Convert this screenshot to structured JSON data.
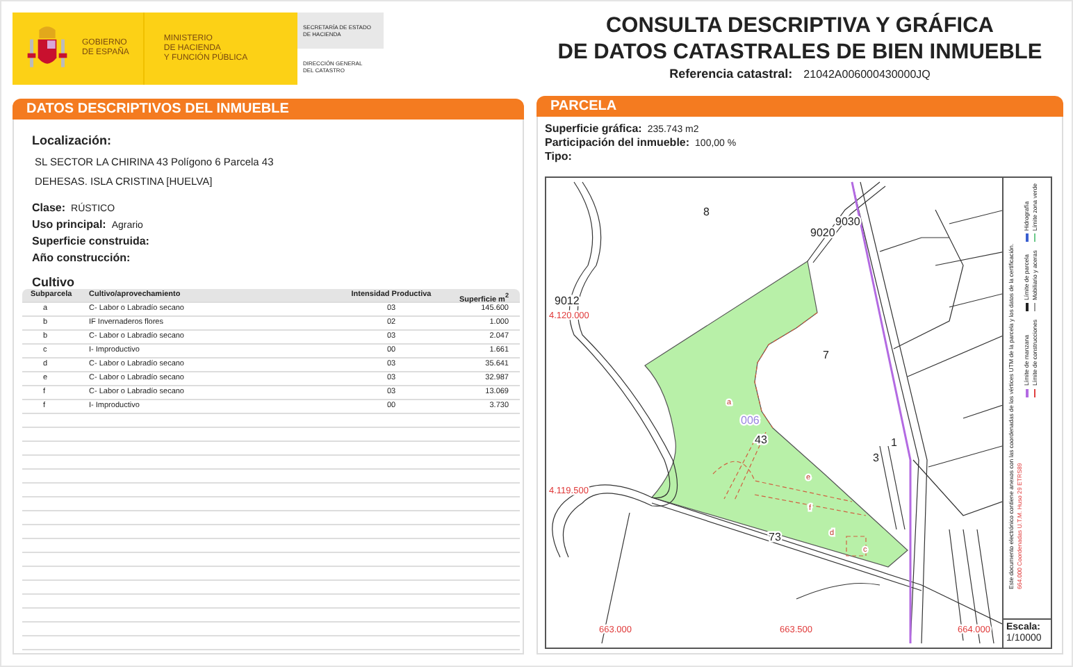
{
  "header": {
    "crown_lines": [
      "GOBIERNO",
      "DE ESPAÑA"
    ],
    "ministry_lines": [
      "MINISTERIO",
      "DE HACIENDA",
      "Y FUNCIÓN PÚBLICA"
    ],
    "secretaria_lines": [
      "SECRETARÍA DE ESTADO",
      "DE HACIENDA"
    ],
    "direccion_lines": [
      "DIRECCIÓN GENERAL",
      "DEL CATASTRO"
    ]
  },
  "title_lines": [
    "CONSULTA DESCRIPTIVA Y GRÁFICA",
    "DE DATOS CATASTRALES DE BIEN INMUEBLE"
  ],
  "reference": {
    "label": "Referencia catastral:",
    "value": "21042A006000430000JQ"
  },
  "descriptive": {
    "title": "DATOS DESCRIPTIVOS DEL **INMUEBLE**",
    "location_label": "Localización:",
    "address_lines": [
      "SL SECTOR LA CHIRINA 43 Polígono 6 Parcela 43",
      "DEHESAS. ISLA CRISTINA [HUELVA]"
    ],
    "fields": [
      {
        "label": "Clase:",
        "value": "RÚSTICO"
      },
      {
        "label": "Uso principal:",
        "value": "Agrario"
      },
      {
        "label": "Superficie construida:"
      },
      {
        "label": "Año construcción:"
      }
    ],
    "crop_title": "Cultivo",
    "table": {
      "columns": [
        "Subparcela",
        "Cultivo/aprovechamiento",
        "Intensidad Productiva",
        "Superficie m$^{2}$"
      ],
      "rows": [
        [
          "a",
          "C- Labor o Labradío secano",
          "03",
          "145.600"
        ],
        [
          "b",
          "IF Invernaderos flores",
          "02",
          "1.000"
        ],
        [
          "b",
          "C- Labor o Labradío secano",
          "03",
          "2.047"
        ],
        [
          "c",
          "I- Improductivo",
          "00",
          "1.661"
        ],
        [
          "d",
          "C- Labor o Labradío secano",
          "03",
          "35.641"
        ],
        [
          "e",
          "C- Labor o Labradío secano",
          "03",
          "32.987"
        ],
        [
          "f",
          "C- Labor o Labradío secano",
          "03",
          "13.069"
        ],
        [
          "f",
          "I- Improductivo",
          "00",
          "3.730"
        ]
      ]
    }
  },
  "parcela": {
    "title": "PARCELA",
    "fields": [
      {
        "label": "Superficie gráfica:",
        "value": "235.743 m2"
      },
      {
        "label": "Participación del inmueble:",
        "value": "100,00 %"
      },
      {
        "label": "Tipo:"
      }
    ]
  },
  "map": {
    "labels": [
      {
        "kind": "parcel",
        "text": "8"
      },
      {
        "kind": "parcel",
        "text": "9020"
      },
      {
        "kind": "parcel",
        "text": "9030"
      },
      {
        "kind": "parcel",
        "text": "9012"
      },
      {
        "kind": "parcel",
        "text": "7"
      },
      {
        "kind": "zone",
        "text": "006"
      },
      {
        "kind": "parcel",
        "text": "43"
      },
      {
        "kind": "parcel",
        "text": "1"
      },
      {
        "kind": "parcel",
        "text": "3"
      },
      {
        "kind": "parcel",
        "text": "73"
      },
      {
        "kind": "sub",
        "text": "a"
      },
      {
        "kind": "sub",
        "text": "e"
      },
      {
        "kind": "sub",
        "text": "f"
      },
      {
        "kind": "sub",
        "text": "d"
      },
      {
        "kind": "sub",
        "text": "c"
      },
      {
        "kind": "coord",
        "text": "4.120.000"
      },
      {
        "kind": "coord",
        "text": "4.119.500"
      },
      {
        "kind": "coord",
        "text": "663.000"
      },
      {
        "kind": "coord",
        "text": "663.500"
      },
      {
        "kind": "coord",
        "text": "664.000"
      }
    ],
    "legend": [
      {
        "label": "Límite de manzana",
        "color": "#b36ae2"
      },
      {
        "label": "Límite de parcela",
        "color": "#222222"
      },
      {
        "label": "Hidrografía",
        "color": "#3a5fd0"
      },
      {
        "label": "Límite de construcciones",
        "color": "#e04040"
      },
      {
        "label": "Mobiliario y aceras",
        "color": "#999999"
      },
      {
        "label": "Límite zona verde",
        "color": "#6cc98a"
      }
    ],
    "coordinates_note": "664.000 Coordenadas U.T.M. Huso 29 ETRS89",
    "document_note": "Este documento electrónico contiene anexos con las coordenadas de los vértices UTM de la parcela y los datos de la certificación.",
    "scale": {
      "label": "Escala:",
      "value": "1/10000"
    }
  }
}
